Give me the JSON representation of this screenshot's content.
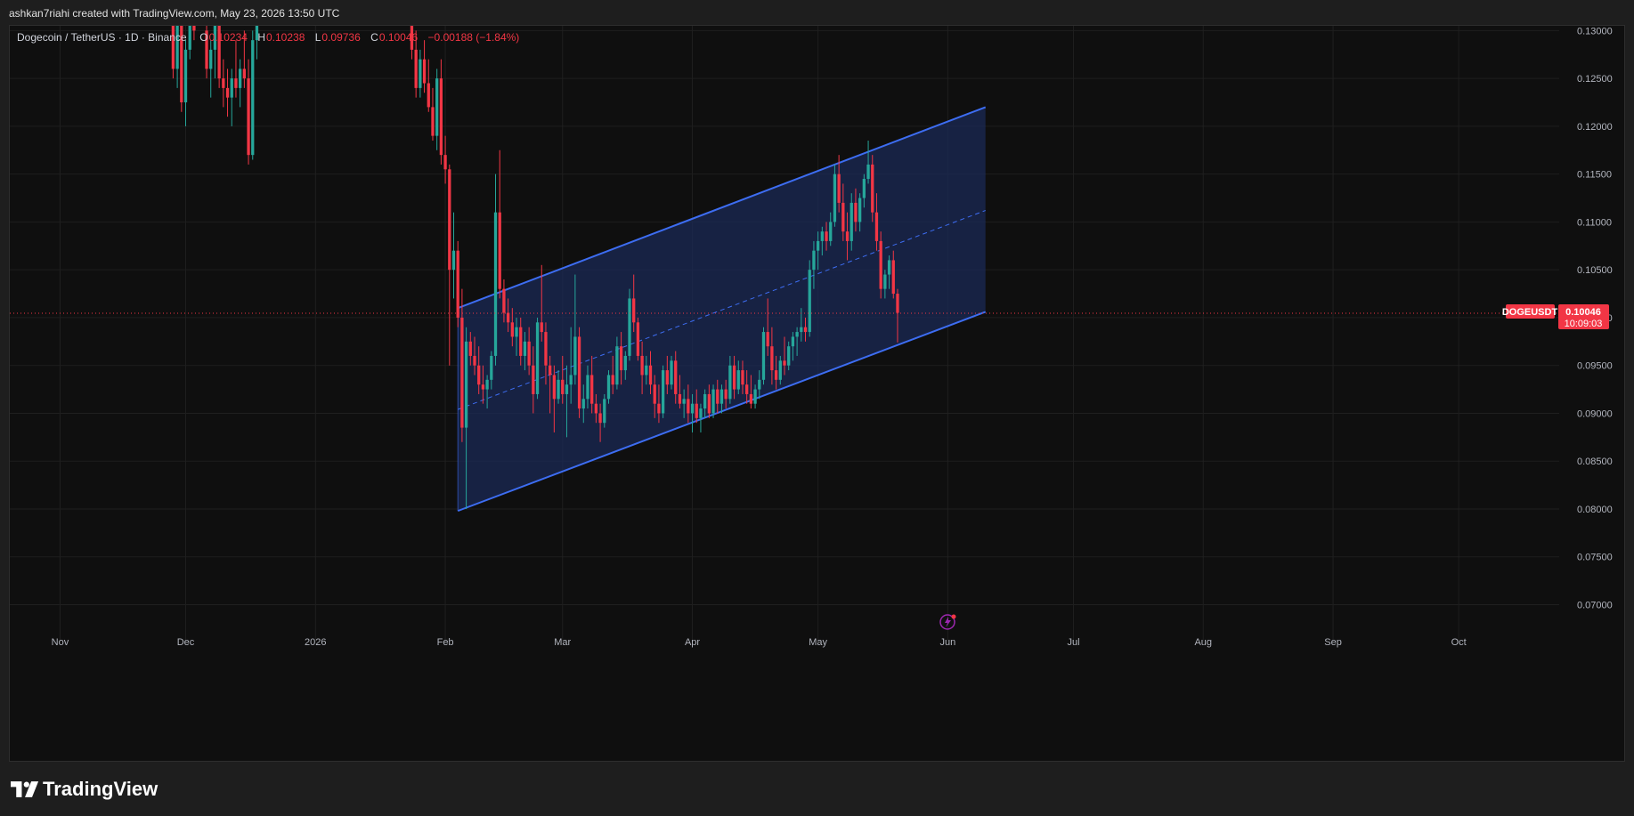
{
  "header": {
    "attribution": "ashkan7riahi created with TradingView.com, May 23, 2026 13:50 UTC"
  },
  "legend": {
    "symbol_desc": "Dogecoin / TetherUS · 1D · Binance",
    "o_label": "O",
    "o_value": "0.10234",
    "h_label": "H",
    "h_value": "0.10238",
    "l_label": "L",
    "l_value": "0.09736",
    "c_label": "C",
    "c_value": "0.10046",
    "change": "−0.00188 (−1.84%)"
  },
  "price_tag": {
    "symbol": "DOGEUSDT",
    "price": "0.10046",
    "countdown": "10:09:03"
  },
  "footer": {
    "brand": "TradingView"
  },
  "colors": {
    "background": "#0f0f0f",
    "up": "#26a69a",
    "down": "#f23645",
    "channel_line": "#3d6df2",
    "channel_fill": "#1b2a55",
    "grid": "#1f1f1f",
    "axis_text": "#b2b5be"
  },
  "chart_data": {
    "type": "candlestick",
    "symbol": "DOGEUSDT",
    "interval": "1D",
    "exchange": "Binance",
    "last_close": 0.10046,
    "ylim": [
      0.068,
      0.1305
    ],
    "y_ticks": [
      0.13,
      0.125,
      0.12,
      0.115,
      0.11,
      0.105,
      0.1,
      0.095,
      0.09,
      0.085,
      0.08,
      0.075,
      0.07
    ],
    "y_tick_labels": [
      "0.13000",
      "0.12500",
      "0.12000",
      "0.11500",
      "0.11000",
      "0.10500",
      "0.10000",
      "0.09500",
      "0.09000",
      "0.08500",
      "0.08000",
      "0.07500",
      "0.07000"
    ],
    "x_start": "2025-10-20",
    "x_end": "2026-10-25",
    "x_ticks": [
      {
        "date": "2025-11-01",
        "label": "Nov"
      },
      {
        "date": "2025-12-01",
        "label": "Dec"
      },
      {
        "date": "2026-01-01",
        "label": "2026"
      },
      {
        "date": "2026-02-01",
        "label": "Feb"
      },
      {
        "date": "2026-03-01",
        "label": "Mar"
      },
      {
        "date": "2026-04-01",
        "label": "Apr"
      },
      {
        "date": "2026-05-01",
        "label": "May"
      },
      {
        "date": "2026-06-01",
        "label": "Jun"
      },
      {
        "date": "2026-07-01",
        "label": "Jul"
      },
      {
        "date": "2026-08-01",
        "label": "Aug"
      },
      {
        "date": "2026-09-01",
        "label": "Sep"
      },
      {
        "date": "2026-10-01",
        "label": "Oct"
      }
    ],
    "channel": {
      "start_date": "2026-02-04",
      "end_date": "2026-06-10",
      "upper_start": 0.101,
      "upper_end": 0.122,
      "lower_start": 0.0798,
      "lower_end": 0.1006,
      "mid_start": 0.0904,
      "mid_end": 0.1112
    },
    "candles": [
      {
        "d": "2025-11-28",
        "o": 0.132,
        "h": 0.137,
        "l": 0.125,
        "c": 0.126
      },
      {
        "d": "2025-11-29",
        "o": 0.126,
        "h": 0.133,
        "l": 0.124,
        "c": 0.131
      },
      {
        "d": "2025-11-30",
        "o": 0.131,
        "h": 0.134,
        "l": 0.1215,
        "c": 0.1225
      },
      {
        "d": "2025-12-01",
        "o": 0.1225,
        "h": 0.129,
        "l": 0.12,
        "c": 0.128
      },
      {
        "d": "2025-12-02",
        "o": 0.128,
        "h": 0.134,
        "l": 0.127,
        "c": 0.132
      },
      {
        "d": "2025-12-03",
        "o": 0.132,
        "h": 0.136,
        "l": 0.129,
        "c": 0.13
      },
      {
        "d": "2025-12-06",
        "o": 0.13,
        "h": 0.133,
        "l": 0.125,
        "c": 0.126
      },
      {
        "d": "2025-12-07",
        "o": 0.126,
        "h": 0.129,
        "l": 0.123,
        "c": 0.128
      },
      {
        "d": "2025-12-08",
        "o": 0.128,
        "h": 0.132,
        "l": 0.125,
        "c": 0.131
      },
      {
        "d": "2025-12-09",
        "o": 0.131,
        "h": 0.134,
        "l": 0.124,
        "c": 0.125
      },
      {
        "d": "2025-12-10",
        "o": 0.125,
        "h": 0.127,
        "l": 0.122,
        "c": 0.124
      },
      {
        "d": "2025-12-11",
        "o": 0.124,
        "h": 0.126,
        "l": 0.121,
        "c": 0.123
      },
      {
        "d": "2025-12-12",
        "o": 0.123,
        "h": 0.126,
        "l": 0.12,
        "c": 0.125
      },
      {
        "d": "2025-12-13",
        "o": 0.125,
        "h": 0.129,
        "l": 0.123,
        "c": 0.124
      },
      {
        "d": "2025-12-14",
        "o": 0.124,
        "h": 0.127,
        "l": 0.122,
        "c": 0.126
      },
      {
        "d": "2025-12-15",
        "o": 0.126,
        "h": 0.13,
        "l": 0.124,
        "c": 0.125
      },
      {
        "d": "2025-12-16",
        "o": 0.125,
        "h": 0.127,
        "l": 0.116,
        "c": 0.117
      },
      {
        "d": "2025-12-17",
        "o": 0.117,
        "h": 0.13,
        "l": 0.1165,
        "c": 0.129
      },
      {
        "d": "2025-12-18",
        "o": 0.129,
        "h": 0.133,
        "l": 0.127,
        "c": 0.132
      },
      {
        "d": "2026-01-24",
        "o": 0.132,
        "h": 0.134,
        "l": 0.127,
        "c": 0.128
      },
      {
        "d": "2026-01-25",
        "o": 0.128,
        "h": 0.13,
        "l": 0.123,
        "c": 0.124
      },
      {
        "d": "2026-01-26",
        "o": 0.124,
        "h": 0.128,
        "l": 0.123,
        "c": 0.127
      },
      {
        "d": "2026-01-27",
        "o": 0.127,
        "h": 0.129,
        "l": 0.1235,
        "c": 0.1245
      },
      {
        "d": "2026-01-28",
        "o": 0.1245,
        "h": 0.127,
        "l": 0.1215,
        "c": 0.122
      },
      {
        "d": "2026-01-29",
        "o": 0.122,
        "h": 0.124,
        "l": 0.1185,
        "c": 0.119
      },
      {
        "d": "2026-01-30",
        "o": 0.119,
        "h": 0.126,
        "l": 0.1175,
        "c": 0.125
      },
      {
        "d": "2026-01-31",
        "o": 0.125,
        "h": 0.127,
        "l": 0.116,
        "c": 0.117
      },
      {
        "d": "2026-02-01",
        "o": 0.117,
        "h": 0.119,
        "l": 0.114,
        "c": 0.1155
      },
      {
        "d": "2026-02-02",
        "o": 0.1155,
        "h": 0.116,
        "l": 0.095,
        "c": 0.105
      },
      {
        "d": "2026-02-03",
        "o": 0.105,
        "h": 0.111,
        "l": 0.102,
        "c": 0.107
      },
      {
        "d": "2026-02-04",
        "o": 0.107,
        "h": 0.108,
        "l": 0.099,
        "c": 0.1
      },
      {
        "d": "2026-02-05",
        "o": 0.1,
        "h": 0.103,
        "l": 0.087,
        "c": 0.0885
      },
      {
        "d": "2026-02-06",
        "o": 0.0885,
        "h": 0.099,
        "l": 0.08,
        "c": 0.0975
      },
      {
        "d": "2026-02-07",
        "o": 0.0975,
        "h": 0.0985,
        "l": 0.095,
        "c": 0.096
      },
      {
        "d": "2026-02-08",
        "o": 0.096,
        "h": 0.098,
        "l": 0.094,
        "c": 0.095
      },
      {
        "d": "2026-02-09",
        "o": 0.095,
        "h": 0.097,
        "l": 0.092,
        "c": 0.093
      },
      {
        "d": "2026-02-10",
        "o": 0.093,
        "h": 0.095,
        "l": 0.091,
        "c": 0.0925
      },
      {
        "d": "2026-02-11",
        "o": 0.0925,
        "h": 0.094,
        "l": 0.0905,
        "c": 0.0935
      },
      {
        "d": "2026-02-12",
        "o": 0.0935,
        "h": 0.0965,
        "l": 0.0925,
        "c": 0.096
      },
      {
        "d": "2026-02-13",
        "o": 0.096,
        "h": 0.115,
        "l": 0.095,
        "c": 0.111
      },
      {
        "d": "2026-02-14",
        "o": 0.111,
        "h": 0.1175,
        "l": 0.102,
        "c": 0.103
      },
      {
        "d": "2026-02-15",
        "o": 0.103,
        "h": 0.104,
        "l": 0.0995,
        "c": 0.1005
      },
      {
        "d": "2026-02-16",
        "o": 0.1005,
        "h": 0.102,
        "l": 0.0985,
        "c": 0.0995
      },
      {
        "d": "2026-02-17",
        "o": 0.0995,
        "h": 0.101,
        "l": 0.097,
        "c": 0.098
      },
      {
        "d": "2026-02-18",
        "o": 0.098,
        "h": 0.1,
        "l": 0.096,
        "c": 0.099
      },
      {
        "d": "2026-02-19",
        "o": 0.099,
        "h": 0.1,
        "l": 0.095,
        "c": 0.096
      },
      {
        "d": "2026-02-20",
        "o": 0.096,
        "h": 0.0985,
        "l": 0.0945,
        "c": 0.0975
      },
      {
        "d": "2026-02-21",
        "o": 0.0975,
        "h": 0.099,
        "l": 0.094,
        "c": 0.095
      },
      {
        "d": "2026-02-22",
        "o": 0.095,
        "h": 0.097,
        "l": 0.09,
        "c": 0.092
      },
      {
        "d": "2026-02-23",
        "o": 0.092,
        "h": 0.1,
        "l": 0.0915,
        "c": 0.0995
      },
      {
        "d": "2026-02-24",
        "o": 0.0995,
        "h": 0.1055,
        "l": 0.0975,
        "c": 0.0985
      },
      {
        "d": "2026-02-25",
        "o": 0.0985,
        "h": 0.0995,
        "l": 0.093,
        "c": 0.095
      },
      {
        "d": "2026-02-26",
        "o": 0.095,
        "h": 0.096,
        "l": 0.09,
        "c": 0.094
      },
      {
        "d": "2026-02-27",
        "o": 0.094,
        "h": 0.095,
        "l": 0.088,
        "c": 0.0915
      },
      {
        "d": "2026-02-28",
        "o": 0.0915,
        "h": 0.0945,
        "l": 0.091,
        "c": 0.0935
      },
      {
        "d": "2026-03-01",
        "o": 0.0935,
        "h": 0.096,
        "l": 0.091,
        "c": 0.092
      },
      {
        "d": "2026-03-02",
        "o": 0.092,
        "h": 0.095,
        "l": 0.0875,
        "c": 0.093
      },
      {
        "d": "2026-03-03",
        "o": 0.093,
        "h": 0.099,
        "l": 0.091,
        "c": 0.094
      },
      {
        "d": "2026-03-04",
        "o": 0.094,
        "h": 0.1045,
        "l": 0.093,
        "c": 0.098
      },
      {
        "d": "2026-03-05",
        "o": 0.098,
        "h": 0.099,
        "l": 0.0895,
        "c": 0.0905
      },
      {
        "d": "2026-03-06",
        "o": 0.0905,
        "h": 0.093,
        "l": 0.089,
        "c": 0.0915
      },
      {
        "d": "2026-03-07",
        "o": 0.0915,
        "h": 0.095,
        "l": 0.0905,
        "c": 0.094
      },
      {
        "d": "2026-03-08",
        "o": 0.094,
        "h": 0.096,
        "l": 0.09,
        "c": 0.091
      },
      {
        "d": "2026-03-09",
        "o": 0.091,
        "h": 0.092,
        "l": 0.089,
        "c": 0.09
      },
      {
        "d": "2026-03-10",
        "o": 0.09,
        "h": 0.091,
        "l": 0.087,
        "c": 0.089
      },
      {
        "d": "2026-03-11",
        "o": 0.089,
        "h": 0.092,
        "l": 0.0885,
        "c": 0.0915
      },
      {
        "d": "2026-03-12",
        "o": 0.0915,
        "h": 0.0945,
        "l": 0.091,
        "c": 0.094
      },
      {
        "d": "2026-03-13",
        "o": 0.094,
        "h": 0.096,
        "l": 0.092,
        "c": 0.093
      },
      {
        "d": "2026-03-14",
        "o": 0.093,
        "h": 0.098,
        "l": 0.0925,
        "c": 0.097
      },
      {
        "d": "2026-03-15",
        "o": 0.097,
        "h": 0.0985,
        "l": 0.093,
        "c": 0.0945
      },
      {
        "d": "2026-03-16",
        "o": 0.0945,
        "h": 0.0965,
        "l": 0.0935,
        "c": 0.096
      },
      {
        "d": "2026-03-17",
        "o": 0.096,
        "h": 0.103,
        "l": 0.0955,
        "c": 0.102
      },
      {
        "d": "2026-03-18",
        "o": 0.102,
        "h": 0.1045,
        "l": 0.0985,
        "c": 0.0995
      },
      {
        "d": "2026-03-19",
        "o": 0.0995,
        "h": 0.1,
        "l": 0.0955,
        "c": 0.096
      },
      {
        "d": "2026-03-20",
        "o": 0.096,
        "h": 0.0975,
        "l": 0.092,
        "c": 0.094
      },
      {
        "d": "2026-03-21",
        "o": 0.094,
        "h": 0.096,
        "l": 0.093,
        "c": 0.095
      },
      {
        "d": "2026-03-22",
        "o": 0.095,
        "h": 0.0965,
        "l": 0.092,
        "c": 0.093
      },
      {
        "d": "2026-03-23",
        "o": 0.093,
        "h": 0.094,
        "l": 0.0895,
        "c": 0.091
      },
      {
        "d": "2026-03-24",
        "o": 0.091,
        "h": 0.093,
        "l": 0.089,
        "c": 0.09
      },
      {
        "d": "2026-03-25",
        "o": 0.09,
        "h": 0.095,
        "l": 0.0895,
        "c": 0.0945
      },
      {
        "d": "2026-03-26",
        "o": 0.0945,
        "h": 0.096,
        "l": 0.092,
        "c": 0.093
      },
      {
        "d": "2026-03-27",
        "o": 0.093,
        "h": 0.096,
        "l": 0.0925,
        "c": 0.0955
      },
      {
        "d": "2026-03-28",
        "o": 0.0955,
        "h": 0.0965,
        "l": 0.091,
        "c": 0.092
      },
      {
        "d": "2026-03-29",
        "o": 0.092,
        "h": 0.094,
        "l": 0.0905,
        "c": 0.091
      },
      {
        "d": "2026-03-30",
        "o": 0.091,
        "h": 0.0925,
        "l": 0.0895,
        "c": 0.0915
      },
      {
        "d": "2026-03-31",
        "o": 0.0915,
        "h": 0.093,
        "l": 0.089,
        "c": 0.09
      },
      {
        "d": "2026-04-01",
        "o": 0.09,
        "h": 0.092,
        "l": 0.088,
        "c": 0.091
      },
      {
        "d": "2026-04-02",
        "o": 0.091,
        "h": 0.0925,
        "l": 0.089,
        "c": 0.0895
      },
      {
        "d": "2026-04-03",
        "o": 0.0895,
        "h": 0.091,
        "l": 0.088,
        "c": 0.0905
      },
      {
        "d": "2026-04-04",
        "o": 0.0905,
        "h": 0.0925,
        "l": 0.0895,
        "c": 0.092
      },
      {
        "d": "2026-04-05",
        "o": 0.092,
        "h": 0.093,
        "l": 0.0895,
        "c": 0.09
      },
      {
        "d": "2026-04-06",
        "o": 0.09,
        "h": 0.093,
        "l": 0.0895,
        "c": 0.0925
      },
      {
        "d": "2026-04-07",
        "o": 0.0925,
        "h": 0.0935,
        "l": 0.09,
        "c": 0.091
      },
      {
        "d": "2026-04-08",
        "o": 0.091,
        "h": 0.093,
        "l": 0.09,
        "c": 0.0925
      },
      {
        "d": "2026-04-09",
        "o": 0.0925,
        "h": 0.0935,
        "l": 0.0905,
        "c": 0.0915
      },
      {
        "d": "2026-04-10",
        "o": 0.0915,
        "h": 0.096,
        "l": 0.091,
        "c": 0.095
      },
      {
        "d": "2026-04-11",
        "o": 0.095,
        "h": 0.096,
        "l": 0.0915,
        "c": 0.0925
      },
      {
        "d": "2026-04-12",
        "o": 0.0925,
        "h": 0.0955,
        "l": 0.092,
        "c": 0.0945
      },
      {
        "d": "2026-04-13",
        "o": 0.0945,
        "h": 0.0955,
        "l": 0.092,
        "c": 0.093
      },
      {
        "d": "2026-04-14",
        "o": 0.093,
        "h": 0.0945,
        "l": 0.091,
        "c": 0.092
      },
      {
        "d": "2026-04-15",
        "o": 0.092,
        "h": 0.094,
        "l": 0.0905,
        "c": 0.091
      },
      {
        "d": "2026-04-16",
        "o": 0.091,
        "h": 0.093,
        "l": 0.0905,
        "c": 0.0925
      },
      {
        "d": "2026-04-17",
        "o": 0.0925,
        "h": 0.0945,
        "l": 0.0915,
        "c": 0.0935
      },
      {
        "d": "2026-04-18",
        "o": 0.0935,
        "h": 0.099,
        "l": 0.093,
        "c": 0.0985
      },
      {
        "d": "2026-04-19",
        "o": 0.0985,
        "h": 0.102,
        "l": 0.096,
        "c": 0.097
      },
      {
        "d": "2026-04-20",
        "o": 0.097,
        "h": 0.099,
        "l": 0.093,
        "c": 0.0945
      },
      {
        "d": "2026-04-21",
        "o": 0.0945,
        "h": 0.096,
        "l": 0.0925,
        "c": 0.0935
      },
      {
        "d": "2026-04-22",
        "o": 0.0935,
        "h": 0.096,
        "l": 0.093,
        "c": 0.0955
      },
      {
        "d": "2026-04-23",
        "o": 0.0955,
        "h": 0.098,
        "l": 0.094,
        "c": 0.095
      },
      {
        "d": "2026-04-24",
        "o": 0.095,
        "h": 0.0975,
        "l": 0.0945,
        "c": 0.097
      },
      {
        "d": "2026-04-25",
        "o": 0.097,
        "h": 0.0985,
        "l": 0.0955,
        "c": 0.098
      },
      {
        "d": "2026-04-26",
        "o": 0.098,
        "h": 0.099,
        "l": 0.096,
        "c": 0.0985
      },
      {
        "d": "2026-04-27",
        "o": 0.0985,
        "h": 0.101,
        "l": 0.0975,
        "c": 0.099
      },
      {
        "d": "2026-04-28",
        "o": 0.099,
        "h": 0.1,
        "l": 0.0975,
        "c": 0.0985
      },
      {
        "d": "2026-04-29",
        "o": 0.0985,
        "h": 0.106,
        "l": 0.098,
        "c": 0.105
      },
      {
        "d": "2026-04-30",
        "o": 0.105,
        "h": 0.108,
        "l": 0.103,
        "c": 0.107
      },
      {
        "d": "2026-05-01",
        "o": 0.107,
        "h": 0.109,
        "l": 0.105,
        "c": 0.108
      },
      {
        "d": "2026-05-02",
        "o": 0.108,
        "h": 0.1095,
        "l": 0.1065,
        "c": 0.109
      },
      {
        "d": "2026-05-03",
        "o": 0.109,
        "h": 0.11,
        "l": 0.107,
        "c": 0.108
      },
      {
        "d": "2026-05-04",
        "o": 0.108,
        "h": 0.111,
        "l": 0.1075,
        "c": 0.11
      },
      {
        "d": "2026-05-05",
        "o": 0.11,
        "h": 0.116,
        "l": 0.1095,
        "c": 0.115
      },
      {
        "d": "2026-05-06",
        "o": 0.115,
        "h": 0.117,
        "l": 0.111,
        "c": 0.112
      },
      {
        "d": "2026-05-07",
        "o": 0.112,
        "h": 0.114,
        "l": 0.108,
        "c": 0.109
      },
      {
        "d": "2026-05-08",
        "o": 0.109,
        "h": 0.111,
        "l": 0.106,
        "c": 0.108
      },
      {
        "d": "2026-05-09",
        "o": 0.108,
        "h": 0.113,
        "l": 0.107,
        "c": 0.112
      },
      {
        "d": "2026-05-10",
        "o": 0.112,
        "h": 0.1135,
        "l": 0.109,
        "c": 0.11
      },
      {
        "d": "2026-05-11",
        "o": 0.11,
        "h": 0.113,
        "l": 0.109,
        "c": 0.1125
      },
      {
        "d": "2026-05-12",
        "o": 0.1125,
        "h": 0.115,
        "l": 0.1115,
        "c": 0.1145
      },
      {
        "d": "2026-05-13",
        "o": 0.1145,
        "h": 0.1185,
        "l": 0.114,
        "c": 0.116
      },
      {
        "d": "2026-05-14",
        "o": 0.116,
        "h": 0.117,
        "l": 0.11,
        "c": 0.111
      },
      {
        "d": "2026-05-15",
        "o": 0.111,
        "h": 0.113,
        "l": 0.107,
        "c": 0.108
      },
      {
        "d": "2026-05-16",
        "o": 0.108,
        "h": 0.109,
        "l": 0.102,
        "c": 0.103
      },
      {
        "d": "2026-05-17",
        "o": 0.103,
        "h": 0.105,
        "l": 0.102,
        "c": 0.1045
      },
      {
        "d": "2026-05-18",
        "o": 0.1045,
        "h": 0.1065,
        "l": 0.103,
        "c": 0.106
      },
      {
        "d": "2026-05-19",
        "o": 0.106,
        "h": 0.107,
        "l": 0.102,
        "c": 0.1025
      },
      {
        "d": "2026-05-20",
        "o": 0.1025,
        "h": 0.103,
        "l": 0.0974,
        "c": 0.1005
      }
    ]
  }
}
